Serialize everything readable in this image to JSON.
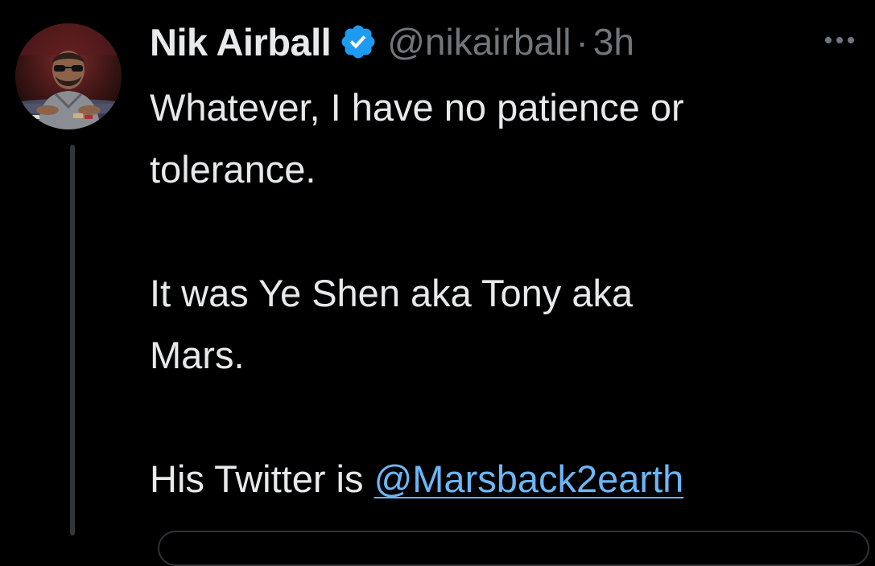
{
  "tweet": {
    "author": {
      "display_name": "Nik Airball",
      "handle": "@nikairball",
      "verified_icon": "verified-badge-icon",
      "avatar_icon": "profile-photo"
    },
    "separator": "·",
    "timestamp": "3h",
    "more_icon": "more-options-icon",
    "text": {
      "line1": "Whatever, I have no patience or",
      "line2": "tolerance.",
      "line3": "It was Ye Shen aka Tony aka",
      "line4": "Mars.",
      "line5_prefix": "His Twitter is ",
      "mention": "@Marsback2earth"
    }
  },
  "colors": {
    "background": "#000000",
    "primary_text": "#e7e9ea",
    "secondary_text": "#71767b",
    "link": "#6cb6f5",
    "verified": "#1d9bf0",
    "thread_line": "#333639"
  }
}
